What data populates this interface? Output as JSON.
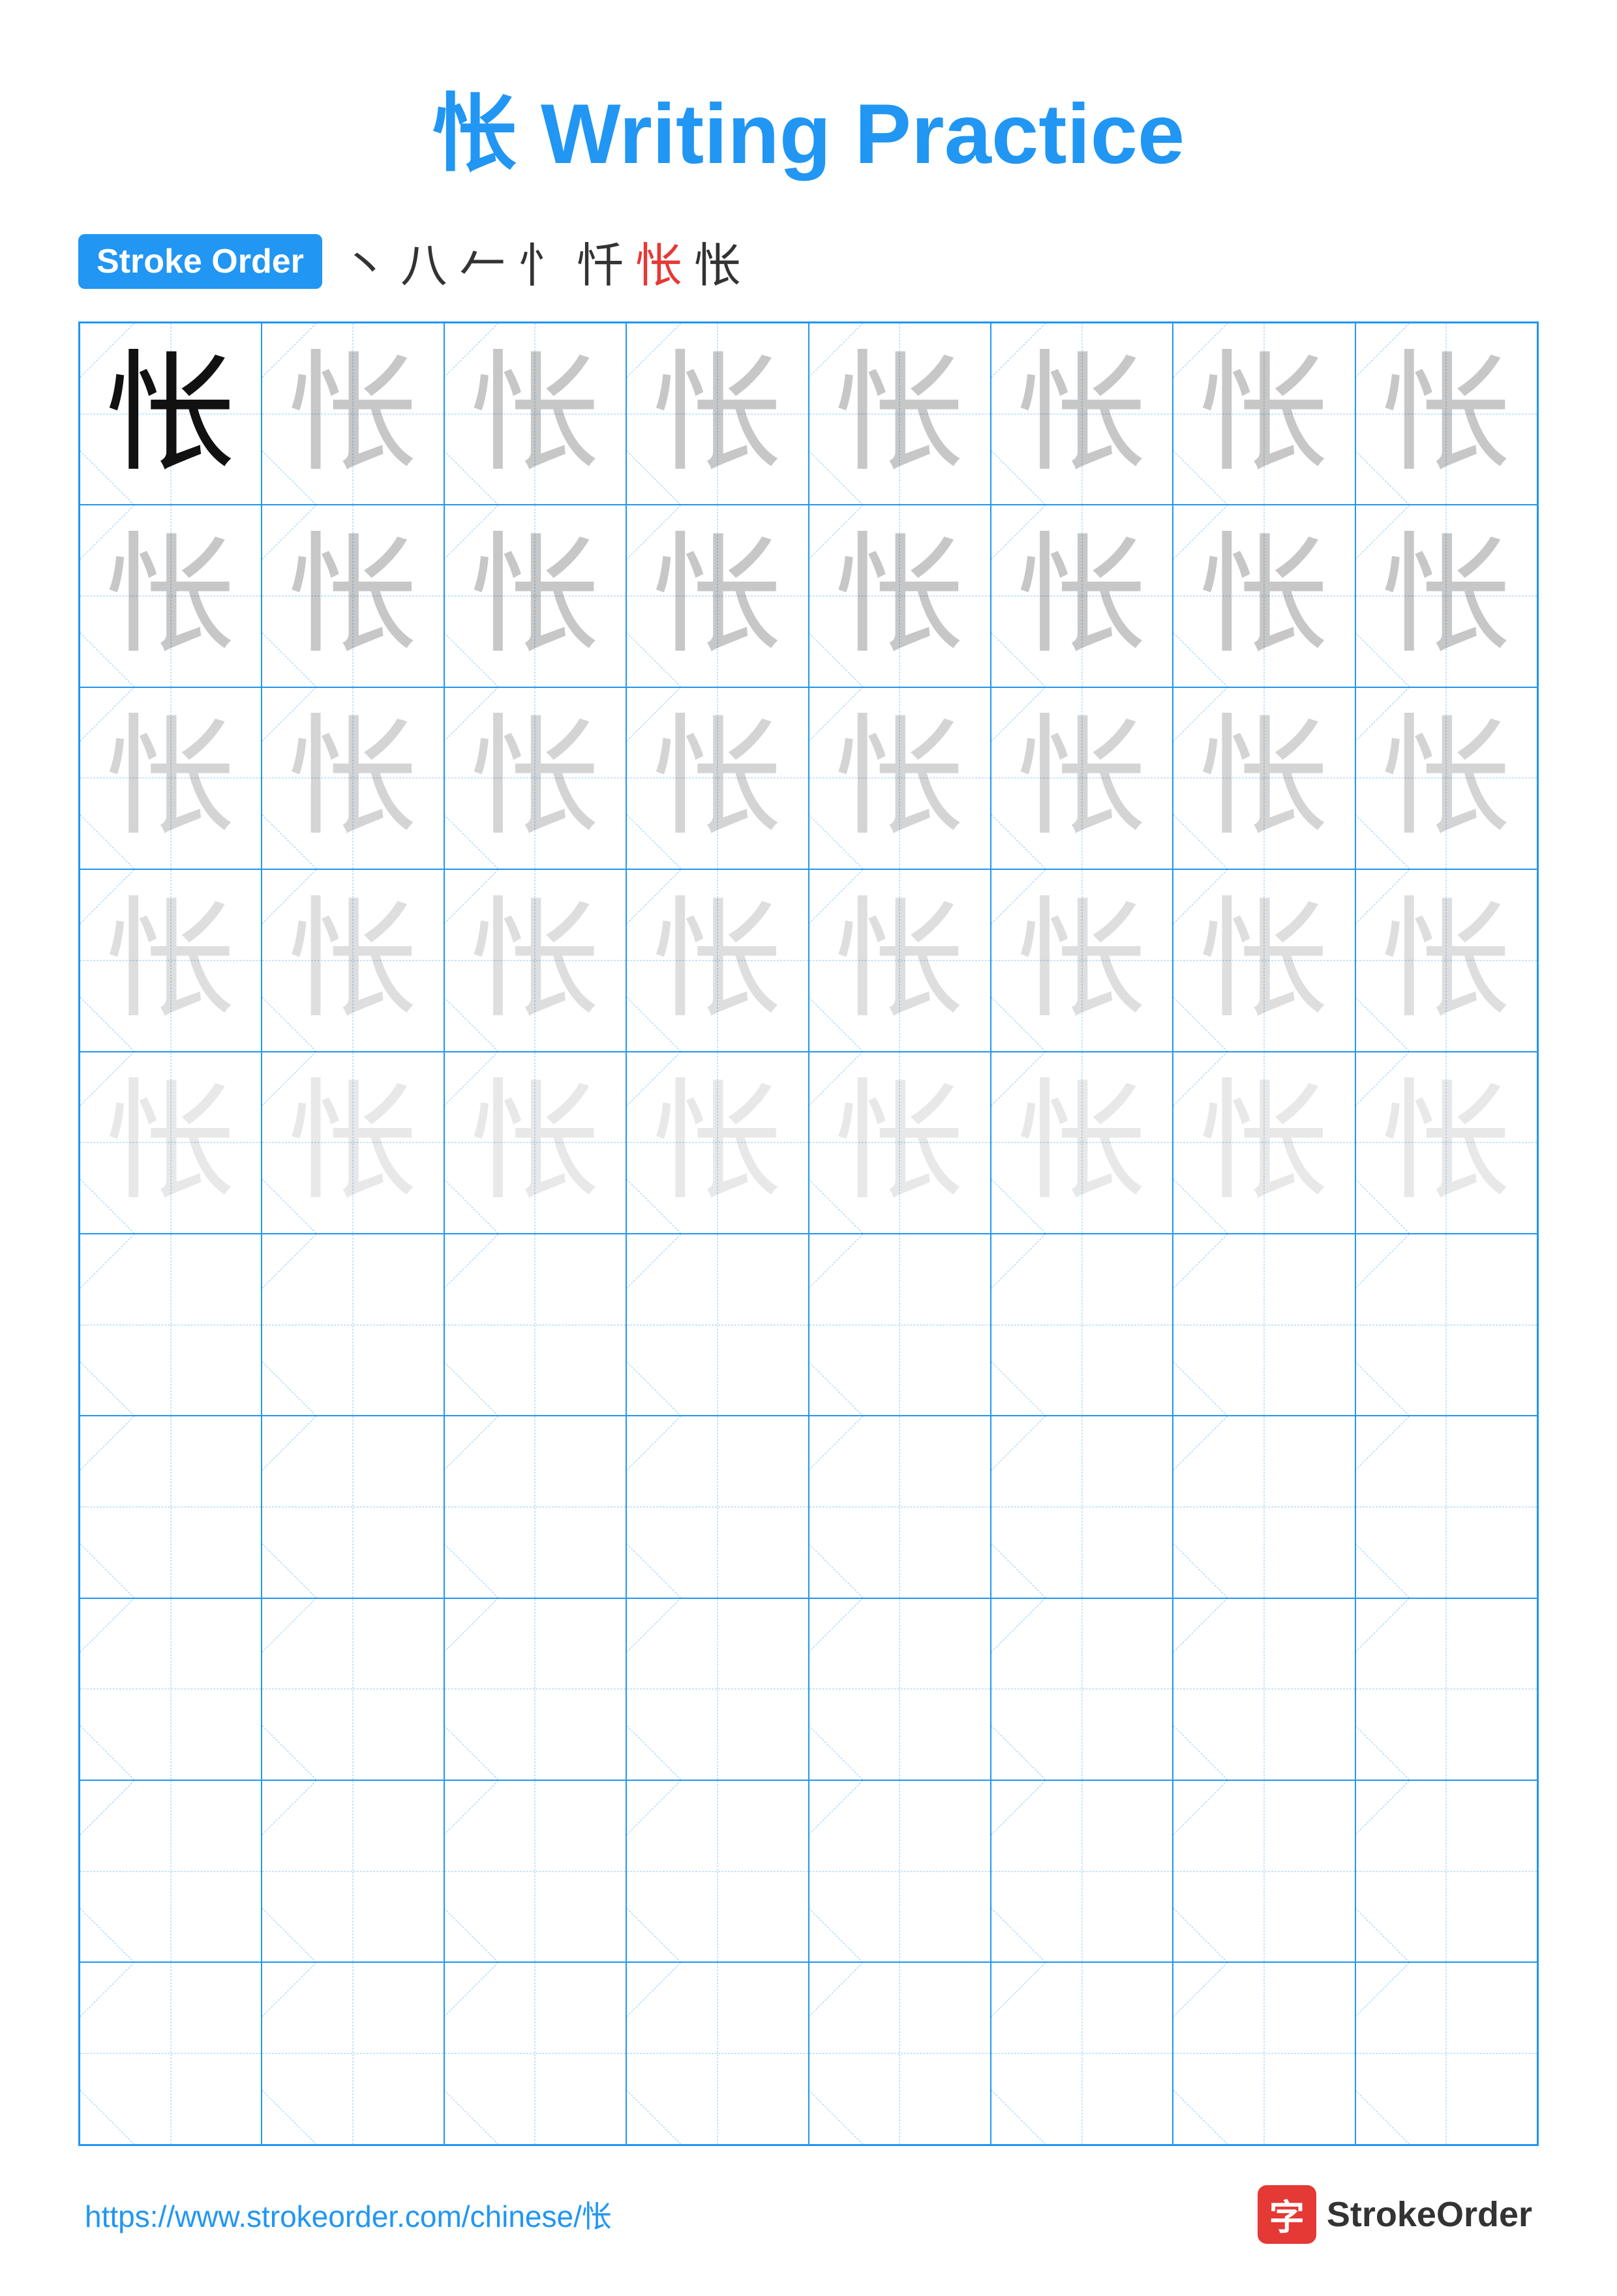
{
  "title": "怅 Writing Practice",
  "stroke_order": {
    "label": "Stroke Order",
    "sequence": [
      "丶",
      "八",
      "𠂉",
      "忄",
      "忏",
      "怅",
      "怅"
    ]
  },
  "character": "怅",
  "grid": {
    "cols": 8,
    "rows": 10,
    "filled_rows": 5
  },
  "footer": {
    "url": "https://www.strokeorder.com/chinese/怅",
    "logo_char": "字",
    "logo_name": "StrokeOrder"
  }
}
